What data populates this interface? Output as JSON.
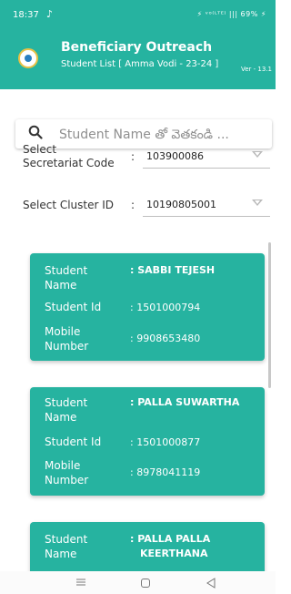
{
  "status_bar": {
    "time": "18:37",
    "note_symbol": "♪",
    "icons_text": "⚡ ᵛᵒ⁽ᴸᵀᴱ⁾ ||| 69% ⚡"
  },
  "header": {
    "title": "Beneficiary Outreach",
    "subtitle": "Student List [ Amma Vodi - 23-24 ]",
    "version": "Ver - 13.1"
  },
  "search": {
    "placeholder": "Student Name తో వెతకండి ..."
  },
  "filters": {
    "secretariat": {
      "label": "Select Secretariat Code",
      "value": "103900086"
    },
    "cluster": {
      "label": "Select Cluster ID",
      "value": "10190805001"
    }
  },
  "students": [
    {
      "name_label": "Student Name",
      "name": ": SABBI TEJESH",
      "id_label": "Student Id",
      "id": ": 1501000794",
      "mobile_label": "Mobile Number",
      "mobile": ": 9908653480"
    },
    {
      "name_label": "Student Name",
      "name": ": PALLA SUWARTHA",
      "id_label": "Student Id",
      "id": ": 1501000877",
      "mobile_label": "Mobile Number",
      "mobile": ": 8978041119"
    },
    {
      "name_label": "Student Name",
      "name": ": PALLA PALLA",
      "name_line2": "KEERTHANA"
    }
  ],
  "colors": {
    "primary": "#26b3a0"
  }
}
